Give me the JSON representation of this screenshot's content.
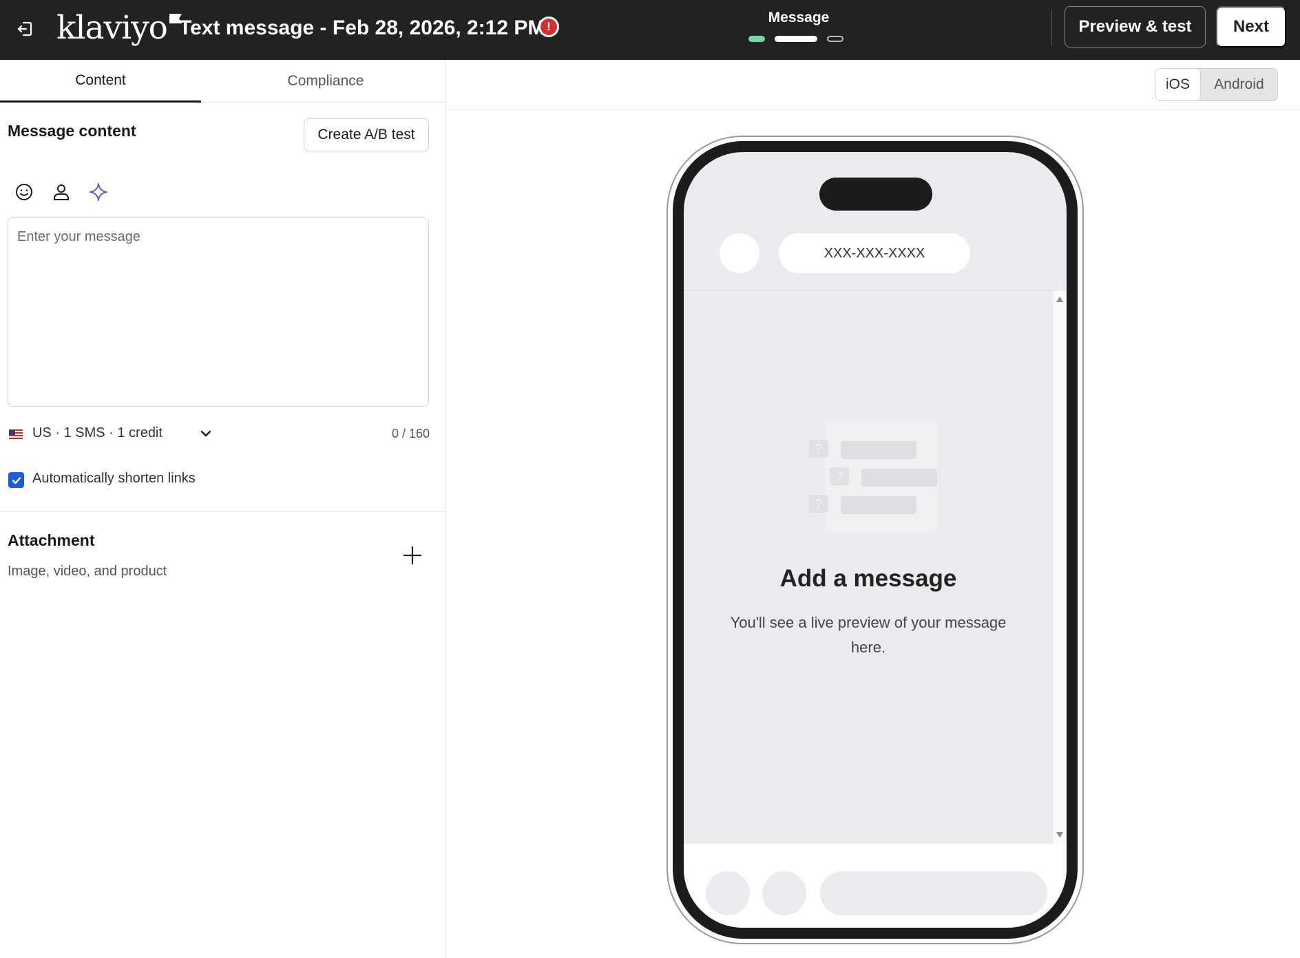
{
  "header": {
    "title": "Text message - Feb 28, 2026, 2:12 PM",
    "logo": "klaviyo",
    "warning_icon": "alert-circle-icon",
    "warning_glyph": "!",
    "step_label": "Message",
    "preview_label": "Preview & test",
    "next_label": "Next"
  },
  "tabs": [
    {
      "label": "Content",
      "active": true
    },
    {
      "label": "Compliance",
      "active": false
    }
  ],
  "message_section": {
    "title": "Message content",
    "ab_button": "Create A/B test",
    "tools": [
      "emoji-icon",
      "person-icon",
      "sparkle-icon"
    ],
    "placeholder": "Enter your message",
    "value": "",
    "sms_info": "US · 1 SMS · 1 credit",
    "char_count": "0 / 160",
    "shorten_links_label": "Automatically shorten links",
    "shorten_links_checked": true
  },
  "attachment": {
    "title": "Attachment",
    "subtitle": "Image, video, and product"
  },
  "preview": {
    "platform_ios": "iOS",
    "platform_android": "Android",
    "selected_platform": "iOS",
    "phone_number": "XXX-XXX-XXXX",
    "empty_title": "Add a message",
    "empty_subtitle": "You'll see a live preview of your message here."
  },
  "colors": {
    "topbar": "#222222",
    "accent_step": "#7dd3a8",
    "checkbox": "#1e5bd6",
    "warning": "#d32f2f",
    "sparkle": "#7b4fc9"
  }
}
